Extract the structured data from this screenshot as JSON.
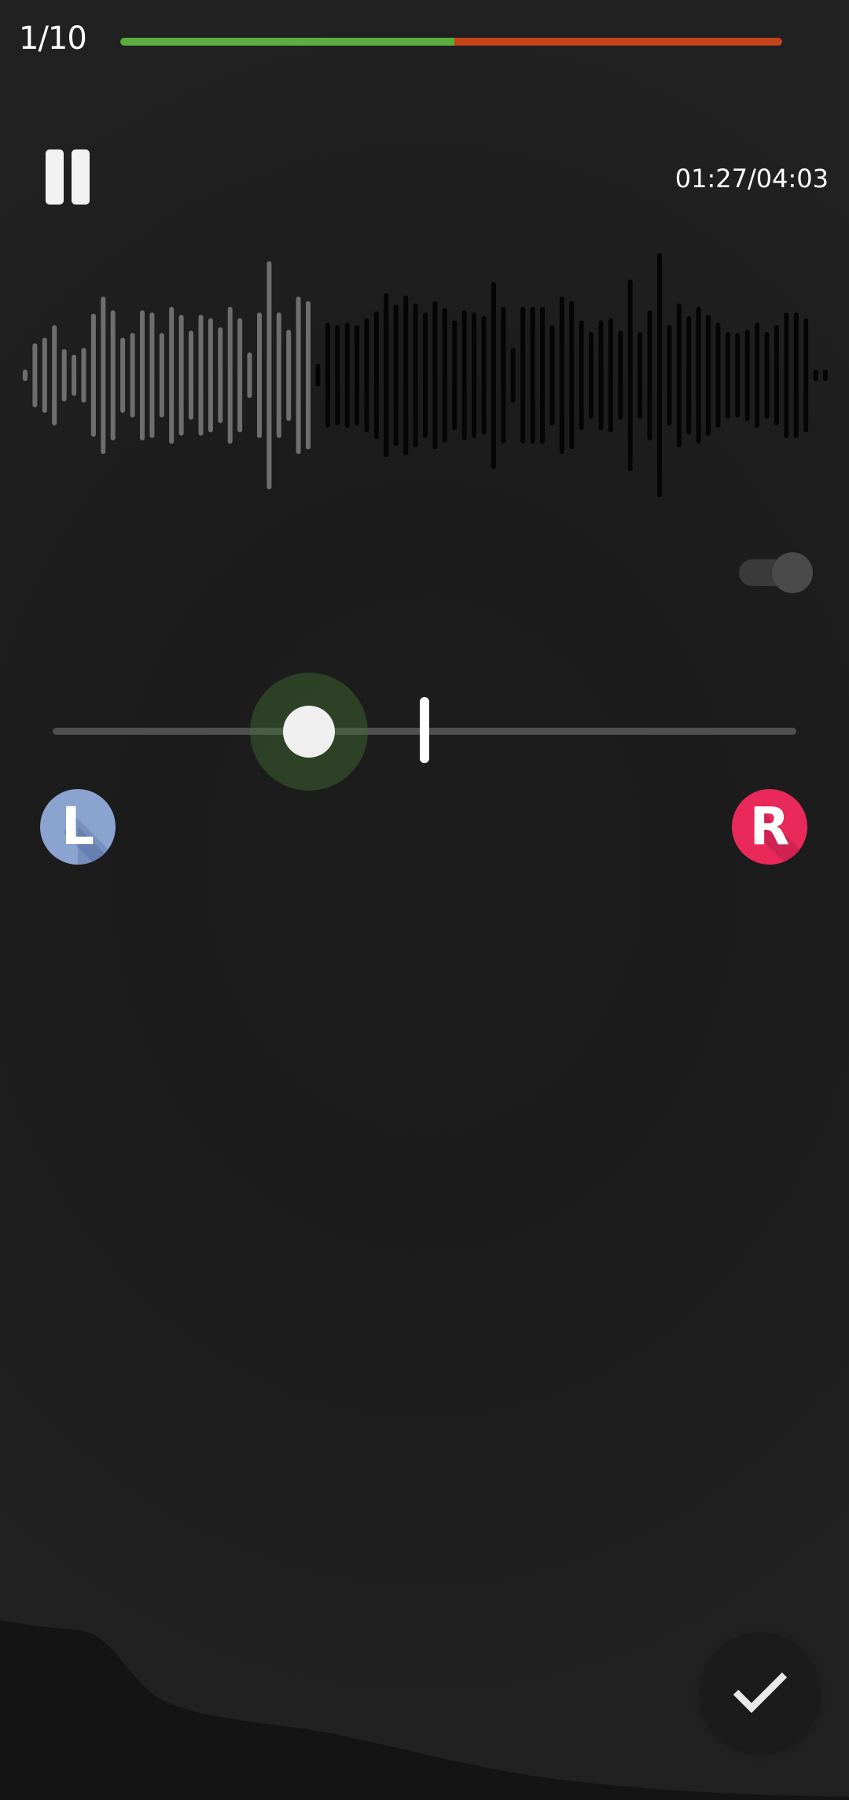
{
  "header": {
    "counter": "1/10",
    "progress": {
      "done_fraction": 0.505,
      "done_color": "#5aad3f",
      "remaining_color": "#c4441c"
    }
  },
  "player": {
    "pause_icon": "pause-icon",
    "time": "01:27/04:03"
  },
  "waveform": {
    "played_fraction": 0.36,
    "played_color": "#6e6e6e",
    "unplayed_color": "#050505",
    "amplitudes": [
      0.05,
      0.28,
      0.33,
      0.44,
      0.23,
      0.18,
      0.24,
      0.54,
      0.69,
      0.57,
      0.33,
      0.37,
      0.57,
      0.55,
      0.37,
      0.6,
      0.53,
      0.39,
      0.53,
      0.5,
      0.42,
      0.6,
      0.5,
      0.2,
      0.55,
      1.0,
      0.55,
      0.4,
      0.69,
      0.65,
      0.1,
      0.46,
      0.44,
      0.46,
      0.44,
      0.5,
      0.56,
      0.72,
      0.62,
      0.7,
      0.63,
      0.55,
      0.65,
      0.59,
      0.48,
      0.57,
      0.55,
      0.52,
      0.82,
      0.6,
      0.24,
      0.6,
      0.6,
      0.6,
      0.44,
      0.69,
      0.65,
      0.48,
      0.38,
      0.48,
      0.5,
      0.39,
      0.84,
      0.38,
      0.57,
      1.07,
      0.44,
      0.63,
      0.52,
      0.6,
      0.53,
      0.46,
      0.38,
      0.37,
      0.4,
      0.46,
      0.38,
      0.44,
      0.55,
      0.55,
      0.5,
      0.05,
      0.05
    ],
    "played_bars": 30
  },
  "toggle": {
    "on": false,
    "icon": "toggle-switch"
  },
  "balance_slider": {
    "value": 0.345,
    "center_marker": 0.5,
    "halo_color": "#436e34"
  },
  "buttons": {
    "left_label": "L",
    "right_label": "R",
    "left_color": "#8aa3cf",
    "right_color": "#e8295a",
    "confirm_icon": "check-icon"
  }
}
